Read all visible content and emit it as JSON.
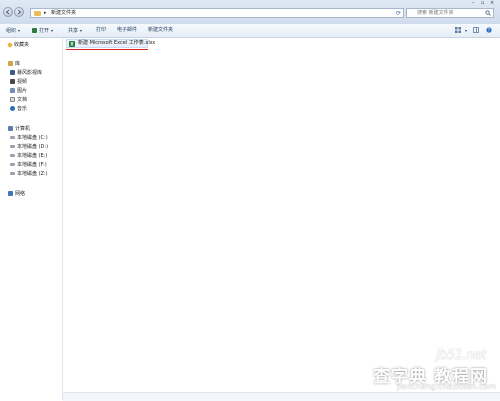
{
  "address": {
    "path": "新建文件夹",
    "separator": "▸"
  },
  "search": {
    "placeholder": "搜索 新建文件夹"
  },
  "toolbar": {
    "organize": "组织",
    "open": "打开",
    "share": "共享",
    "print": "打印",
    "email": "电子邮件",
    "new_folder": "新建文件夹"
  },
  "nav": {
    "favorites": "收藏夹",
    "libraries": "库",
    "lib_items": [
      "暴风影视库",
      "视频",
      "图片",
      "文档",
      "音乐"
    ],
    "computer": "计算机",
    "drives": [
      "本地磁盘 (C:)",
      "本地磁盘 (D:)",
      "本地磁盘 (E:)",
      "本地磁盘 (F:)",
      "本地磁盘 (Z:)"
    ],
    "network": "网络"
  },
  "content": {
    "file_name": "新建 Microsoft Excel 工作表.xlsx"
  },
  "watermark": {
    "site": "jb51.net",
    "main": "查字典 教程网",
    "sub": "jiaocheng.chazidian.com"
  },
  "colors": {
    "accent": "#1e395b",
    "excel_green": "#1d7a3a",
    "underline_red": "#d6262a"
  }
}
